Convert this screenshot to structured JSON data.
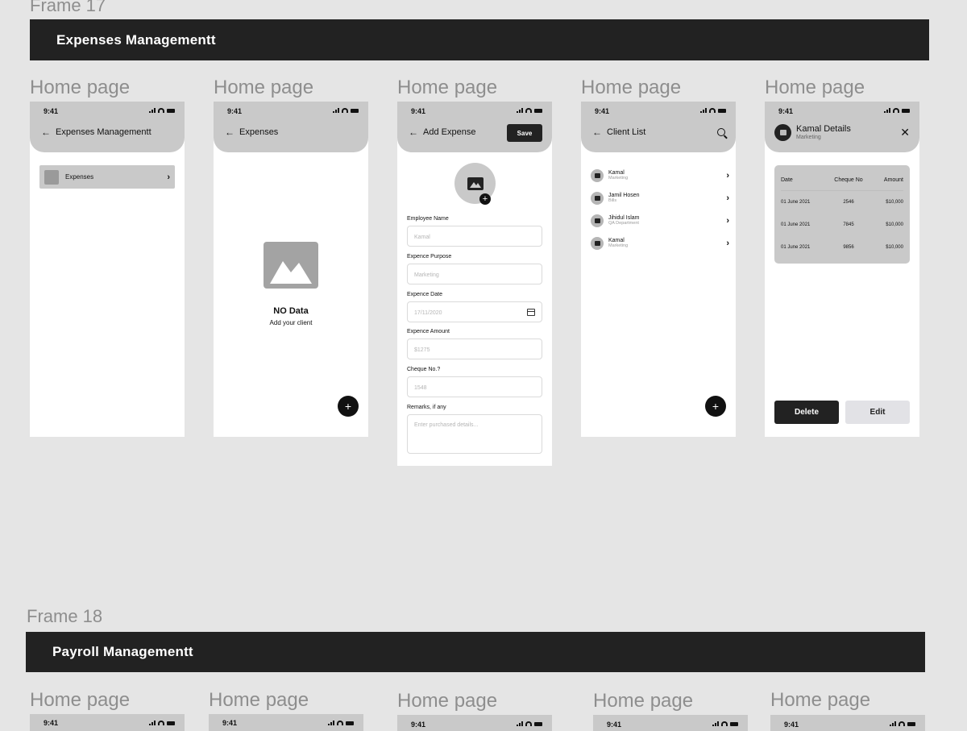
{
  "frame17": {
    "title": "Frame 17",
    "banner": "Expenses Managementt",
    "page_label": "Home page"
  },
  "status": {
    "time": "9:41"
  },
  "screen1": {
    "title": "Expenses Managementt",
    "menu_item": "Expenses"
  },
  "screen2": {
    "title": "Expenses",
    "empty_title": "NO Data",
    "empty_sub": "Add your client",
    "fab": "+"
  },
  "screen3": {
    "title": "Add Expense",
    "save": "Save",
    "fields": [
      {
        "label": "Employee Name",
        "placeholder": "Kamal"
      },
      {
        "label": "Expence Purpose",
        "placeholder": "Marketing"
      },
      {
        "label": "Expence Date",
        "placeholder": "17/11/2020"
      },
      {
        "label": "Expence Amount",
        "placeholder": "$1275"
      },
      {
        "label": "Cheque No.?",
        "placeholder": "1548"
      },
      {
        "label": "Remarks, if any",
        "placeholder": "Enter purchased details..."
      }
    ]
  },
  "screen4": {
    "title": "Client List",
    "clients": [
      {
        "name": "Kamal",
        "sub": "Marketing"
      },
      {
        "name": "Jamil Hosen",
        "sub": "Bills"
      },
      {
        "name": "Jihidul Islam",
        "sub": "QA Department"
      },
      {
        "name": "Kamal",
        "sub": "Marketing"
      }
    ],
    "fab": "+"
  },
  "screen5": {
    "title": "Kamal Details",
    "subtitle": "Marketing",
    "close": "✕",
    "columns": [
      "Date",
      "Cheque No",
      "Amount"
    ],
    "rows": [
      [
        "01 June 2021",
        "2546",
        "$10,000"
      ],
      [
        "01 June 2021",
        "7845",
        "$10,000"
      ],
      [
        "01 June 2021",
        "9856",
        "$10,000"
      ]
    ],
    "delete": "Delete",
    "edit": "Edit"
  },
  "frame18": {
    "title": "Frame 18",
    "banner": "Payroll Managementt",
    "page_label": "Home page"
  }
}
